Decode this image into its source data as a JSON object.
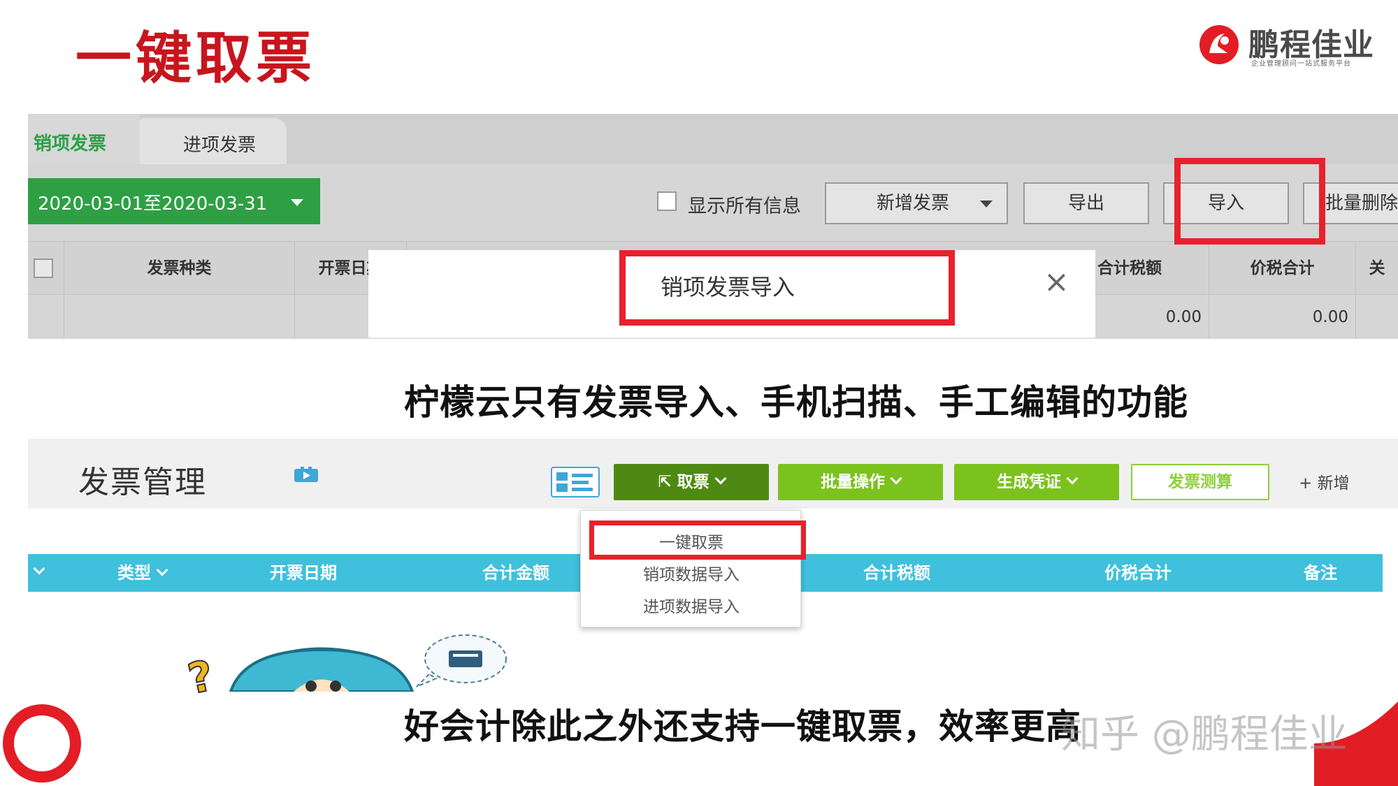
{
  "slide": {
    "title": "一键取票",
    "logo": {
      "name": "鹏程佳业",
      "tagline": "企业管理顾问一站式服务平台"
    },
    "watermark": "知乎 @鹏程佳业",
    "captions": {
      "lemon": "柠檬云只有发票导入、手机扫描、手工编辑的功能",
      "good": "好会计除此之外还支持一键取票，效率更高"
    },
    "highlight_color": "#e8212c",
    "brand_red": "#c8151d"
  },
  "lemon_ui": {
    "tabs": [
      {
        "label": "销项发票",
        "active": true
      },
      {
        "label": "进项发票",
        "active": false
      }
    ],
    "date_range": "2020-03-01至2020-03-31",
    "show_all_info_label": "显示所有信息",
    "buttons": {
      "new_invoice": "新增发票",
      "export": "导出",
      "import": "导入",
      "batch_delete": "批量删除"
    },
    "columns": [
      "发票种类",
      "开票日期",
      "合计税额",
      "价税合计",
      "关"
    ],
    "row_values": {
      "tax_total": "0.00",
      "price_tax_total": "0.00"
    },
    "dialog": {
      "title": "销项发票导入",
      "close": "×"
    }
  },
  "good_ui": {
    "title": "发票管理",
    "buttons": {
      "get_ticket": "取票",
      "batch_ops": "批量操作",
      "gen_voucher": "生成凭证",
      "invoice_calc": "发票测算",
      "add": "+ 新增"
    },
    "dropdown": [
      "一键取票",
      "销项数据导入",
      "进项数据导入"
    ],
    "columns": [
      "类型",
      "开票日期",
      "合计金额",
      "合计税额",
      "价税合计",
      "备注"
    ],
    "accent": "#3fc0dd",
    "green_dark": "#4e8a13",
    "green_light": "#7cc21e"
  }
}
